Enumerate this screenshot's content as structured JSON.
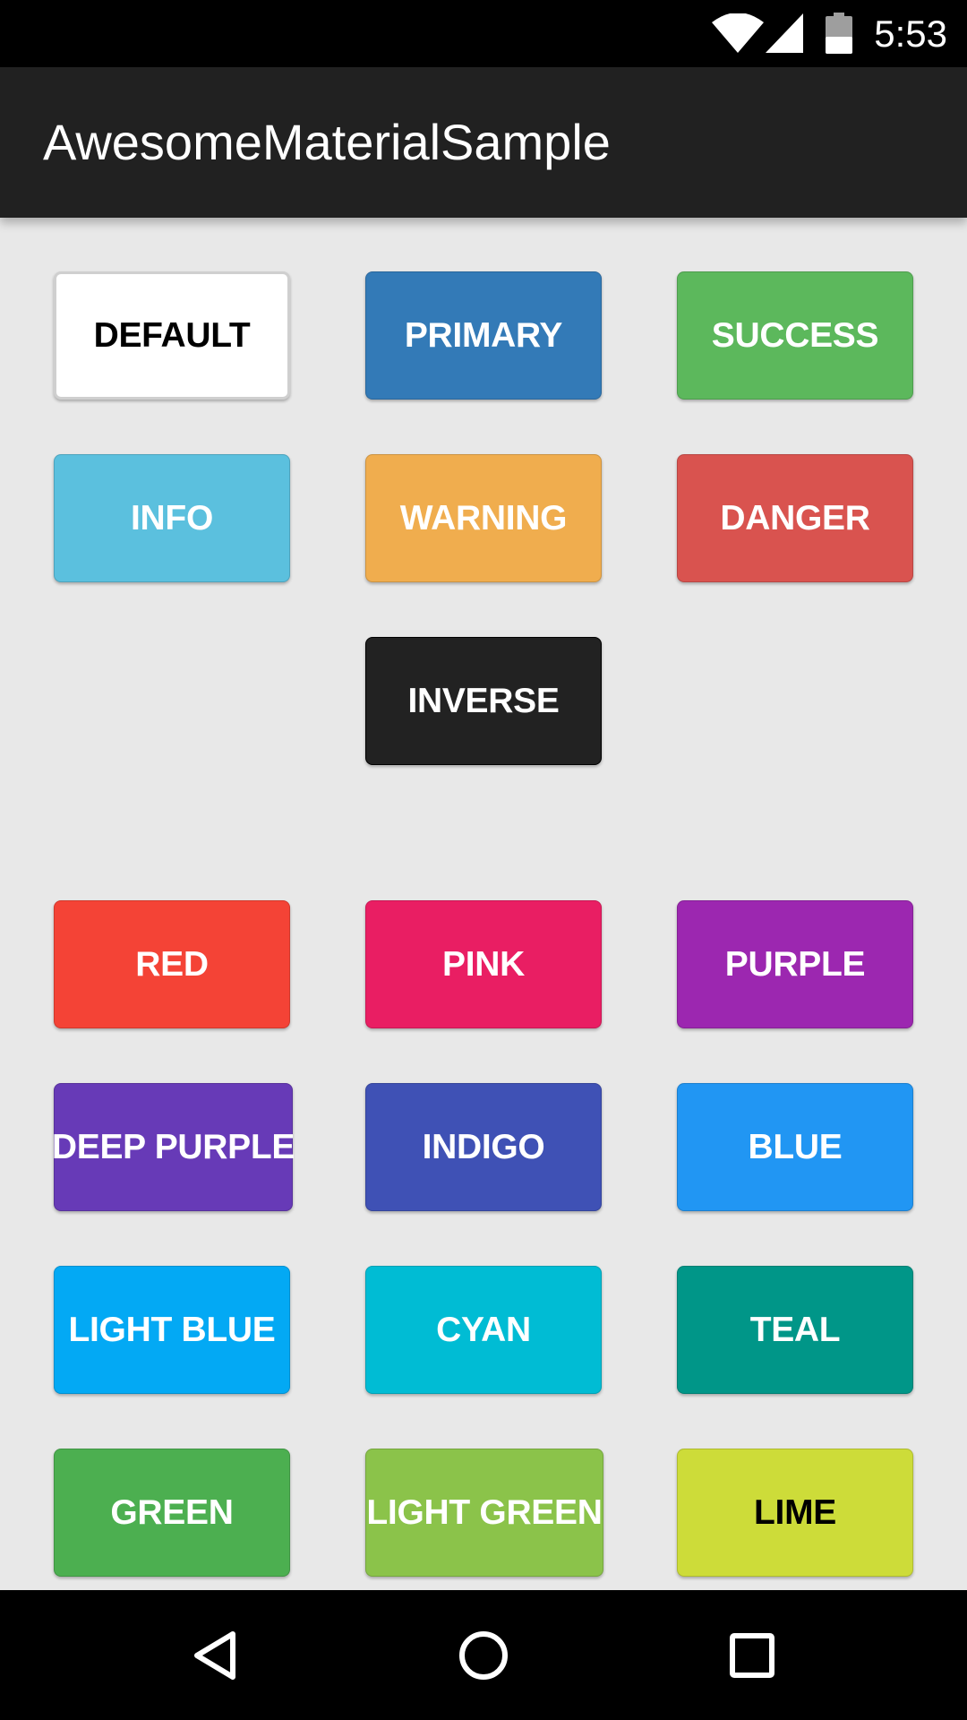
{
  "status_bar": {
    "time": "5:53",
    "icons": [
      "wifi-icon",
      "signal-icon",
      "battery-icon"
    ]
  },
  "app_bar": {
    "title": "AwesomeMaterialSample"
  },
  "bootstrap_buttons": [
    {
      "label": "DEFAULT",
      "color": "#ffffff",
      "text_color": "#000000"
    },
    {
      "label": "PRIMARY",
      "color": "#337ab7",
      "text_color": "#ffffff"
    },
    {
      "label": "SUCCESS",
      "color": "#5cb85c",
      "text_color": "#ffffff"
    },
    {
      "label": "INFO",
      "color": "#5bc0de",
      "text_color": "#ffffff"
    },
    {
      "label": "WARNING",
      "color": "#f0ad4e",
      "text_color": "#ffffff"
    },
    {
      "label": "DANGER",
      "color": "#d9534f",
      "text_color": "#ffffff"
    },
    {
      "label": "INVERSE",
      "color": "#222222",
      "text_color": "#ffffff"
    }
  ],
  "material_buttons": [
    {
      "label": "RED",
      "color": "#f44336",
      "text_color": "#ffffff"
    },
    {
      "label": "PINK",
      "color": "#e91e63",
      "text_color": "#ffffff"
    },
    {
      "label": "PURPLE",
      "color": "#9c27b0",
      "text_color": "#ffffff"
    },
    {
      "label": "DEEP PURPLE",
      "color": "#673ab7",
      "text_color": "#ffffff"
    },
    {
      "label": "INDIGO",
      "color": "#3f51b5",
      "text_color": "#ffffff"
    },
    {
      "label": "BLUE",
      "color": "#2196f3",
      "text_color": "#ffffff"
    },
    {
      "label": "LIGHT BLUE",
      "color": "#03a9f4",
      "text_color": "#ffffff"
    },
    {
      "label": "CYAN",
      "color": "#00bcd4",
      "text_color": "#ffffff"
    },
    {
      "label": "TEAL",
      "color": "#009688",
      "text_color": "#ffffff"
    },
    {
      "label": "GREEN",
      "color": "#4caf50",
      "text_color": "#ffffff"
    },
    {
      "label": "LIGHT GREEN",
      "color": "#8bc34a",
      "text_color": "#ffffff"
    },
    {
      "label": "LIME",
      "color": "#cddc39",
      "text_color": "#000000"
    }
  ],
  "nav_bar": {
    "icons": [
      "back-icon",
      "home-icon",
      "recents-icon"
    ]
  }
}
